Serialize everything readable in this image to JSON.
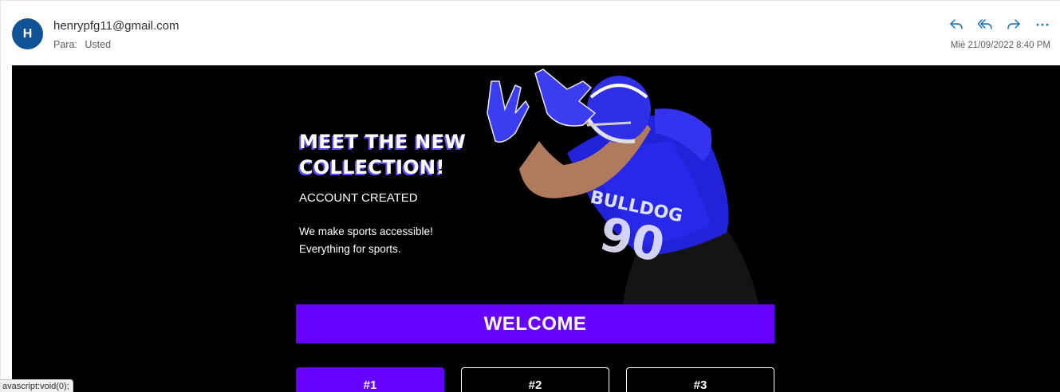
{
  "header": {
    "avatar_initial": "H",
    "sender": "henrypfg11@gmail.com",
    "to_label": "Para:",
    "to_value": "Usted",
    "date": "Mié 21/09/2022 8:40 PM",
    "actions": [
      "reply-icon",
      "reply-all-icon",
      "forward-icon",
      "more-icon"
    ],
    "accent_color": "#0f6cbd"
  },
  "email": {
    "hero_title_line1": "MEET THE NEW",
    "hero_title_line2": "COLLECTION!",
    "hero_subtitle": "ACCOUNT CREATED",
    "hero_text_line1": "We make sports accessible!",
    "hero_text_line2": "Everything for sports.",
    "welcome": "WELCOME",
    "tabs": [
      {
        "label": "#1"
      },
      {
        "label": "#2"
      },
      {
        "label": "#3"
      }
    ],
    "brand_color": "#6600ff",
    "jersey_text": "BULLDOG",
    "jersey_number": "90"
  },
  "statusbar": {
    "text": "avascript:void(0);"
  }
}
